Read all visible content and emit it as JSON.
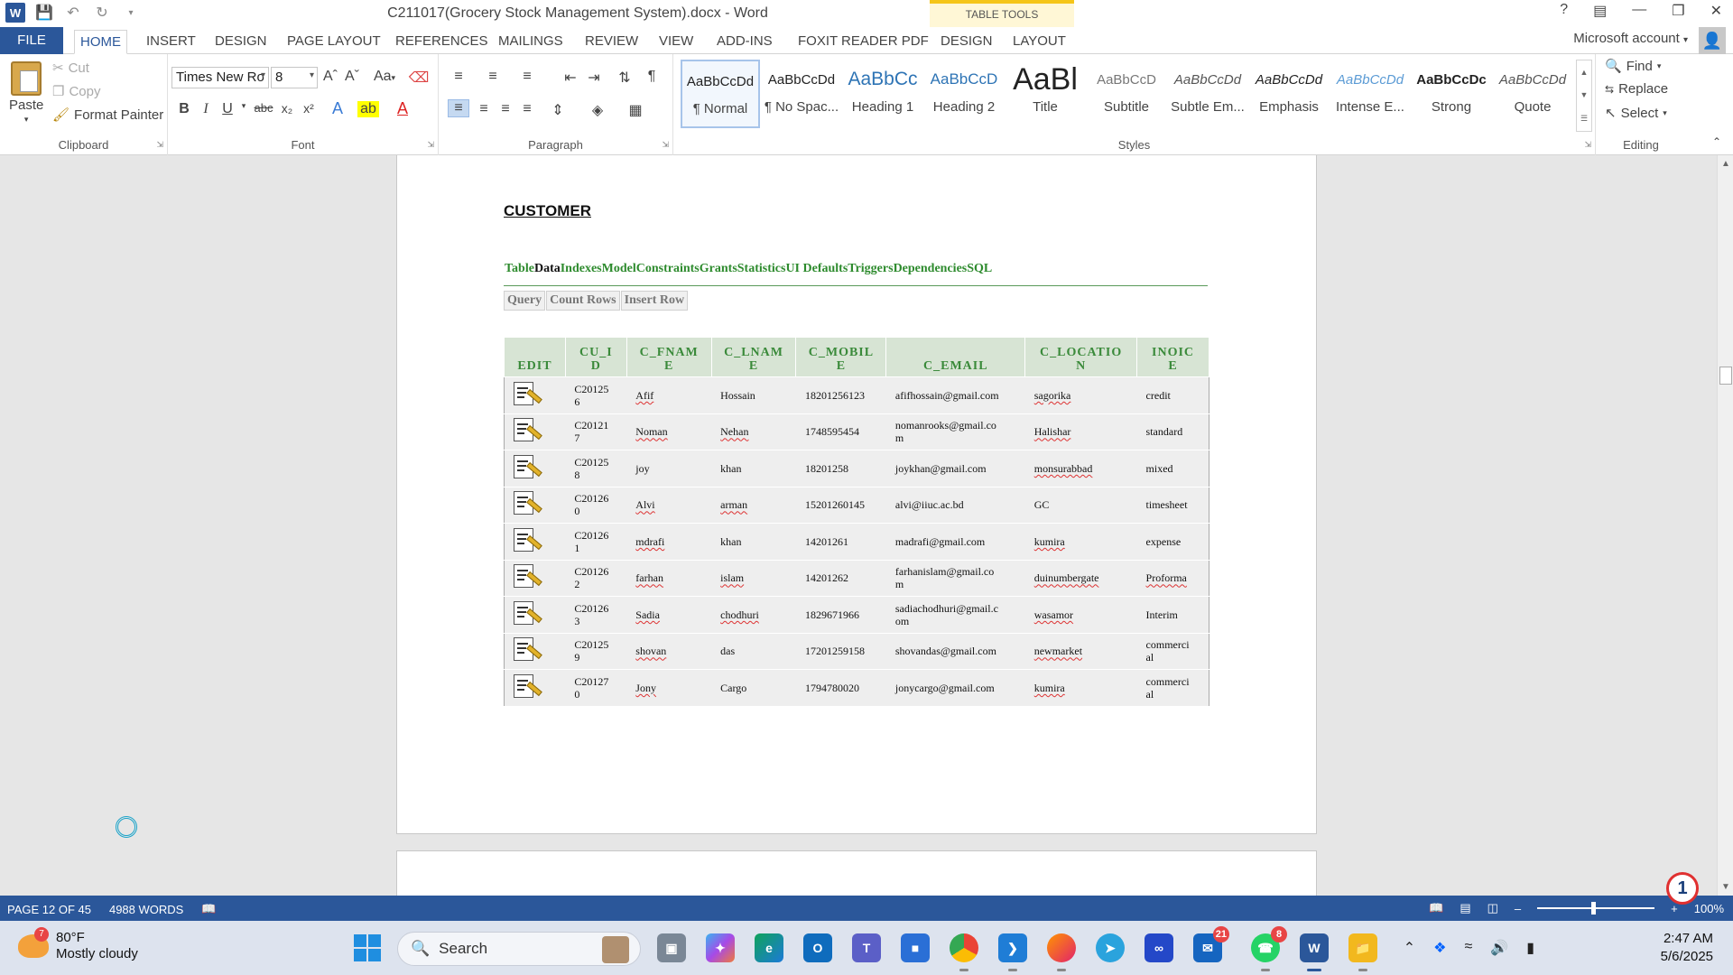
{
  "titlebar": {
    "title": "C211017(Grocery Stock Management System).docx - Word",
    "table_tools": "TABLE TOOLS",
    "help": "?"
  },
  "menu": {
    "file": "FILE",
    "tabs": [
      "HOME",
      "INSERT",
      "DESIGN",
      "PAGE LAYOUT",
      "REFERENCES",
      "MAILINGS",
      "REVIEW",
      "VIEW",
      "ADD-INS",
      "FOXIT READER PDF"
    ],
    "table_tabs": [
      "DESIGN",
      "LAYOUT"
    ],
    "account": "Microsoft account"
  },
  "ribbon": {
    "clipboard": {
      "paste": "Paste",
      "cut": "Cut",
      "copy": "Copy",
      "format_painter": "Format Painter",
      "label": "Clipboard"
    },
    "font": {
      "name": "Times New Ro",
      "size": "8",
      "label": "Font",
      "change_case": "Aa"
    },
    "paragraph": {
      "label": "Paragraph"
    },
    "styles": {
      "label": "Styles",
      "items": [
        {
          "sample": "AaBbCcDd",
          "name": "¶ Normal"
        },
        {
          "sample": "AaBbCcDd",
          "name": "¶ No Spac..."
        },
        {
          "sample": "AaBbCc",
          "name": "Heading 1"
        },
        {
          "sample": "AaBbCcD",
          "name": "Heading 2"
        },
        {
          "sample": "AaBl",
          "name": "Title"
        },
        {
          "sample": "AaBbCcD",
          "name": "Subtitle"
        },
        {
          "sample": "AaBbCcDd",
          "name": "Subtle Em..."
        },
        {
          "sample": "AaBbCcDd",
          "name": "Emphasis"
        },
        {
          "sample": "AaBbCcDd",
          "name": "Intense E..."
        },
        {
          "sample": "AaBbCcDc",
          "name": "Strong"
        },
        {
          "sample": "AaBbCcDd",
          "name": "Quote"
        }
      ]
    },
    "editing": {
      "find": "Find",
      "replace": "Replace",
      "select": "Select",
      "label": "Editing"
    }
  },
  "document": {
    "heading": "CUSTOMER",
    "nav_links": [
      "Table",
      "Data",
      "Indexes",
      "Model",
      "Constraints",
      "Grants",
      "Statistics",
      "UI Defaults",
      "Triggers",
      "Dependencies",
      "SQL"
    ],
    "action_buttons": [
      "Query",
      "Count Rows",
      "Insert Row"
    ],
    "table": {
      "headers": [
        "EDIT",
        "CU_I D",
        "C_FNAM E",
        "C_LNAM E",
        "C_MOBIL E",
        "C_EMAIL",
        "C_LOCATIO N",
        "INOIC E"
      ],
      "rows": [
        [
          "C20125 6",
          "Afif",
          "Hossain",
          "18201256123",
          "afifhossain@gmail.com",
          "sagorika",
          "credit"
        ],
        [
          "C20121 7",
          "Noman",
          "Nehan",
          "1748595454",
          "nomanrooks@gmail.co m",
          "Halishar",
          "standard"
        ],
        [
          "C20125 8",
          "joy",
          "khan",
          "18201258",
          "joykhan@gmail.com",
          "monsurabbad",
          "mixed"
        ],
        [
          "C20126 0",
          "Alvi",
          "arman",
          "15201260145",
          "alvi@iiuc.ac.bd",
          "GC",
          "timesheet"
        ],
        [
          "C20126 1",
          "mdrafi",
          "khan",
          "14201261",
          "madrafi@gmail.com",
          "kumira",
          "expense"
        ],
        [
          "C20126 2",
          "farhan",
          "islam",
          "14201262",
          "farhanislam@gmail.co m",
          "duinumbergate",
          "Proforma"
        ],
        [
          "C20126 3",
          "Sadia",
          "chodhuri",
          "1829671966",
          "sadiachodhuri@gmail.c om",
          "wasamor",
          "Interim"
        ],
        [
          "C20125 9",
          "shovan",
          "das",
          "17201259158",
          "shovandas@gmail.com",
          "newmarket",
          "commerci al"
        ],
        [
          "C20127 0",
          "Jony",
          "Cargo",
          "1794780020",
          "jonycargo@gmail.com",
          "kumira",
          "commerci al"
        ]
      ]
    }
  },
  "statusbar": {
    "page": "PAGE 12 OF 45",
    "words": "4988 WORDS",
    "zoom": "100%"
  },
  "notification_count": "1",
  "taskbar": {
    "weather_temp": "80°F",
    "weather_desc": "Mostly cloudy",
    "weather_badge": "7",
    "search": "Search",
    "outlook_badge": "21",
    "whatsapp_badge": "8",
    "time": "2:47 AM",
    "date": "5/6/2025"
  },
  "colors": {
    "word_blue": "#2b579a",
    "header_green": "#3a8a3a",
    "link_green": "#2e8b2e",
    "table_tools_yellow": "#f5c518"
  }
}
